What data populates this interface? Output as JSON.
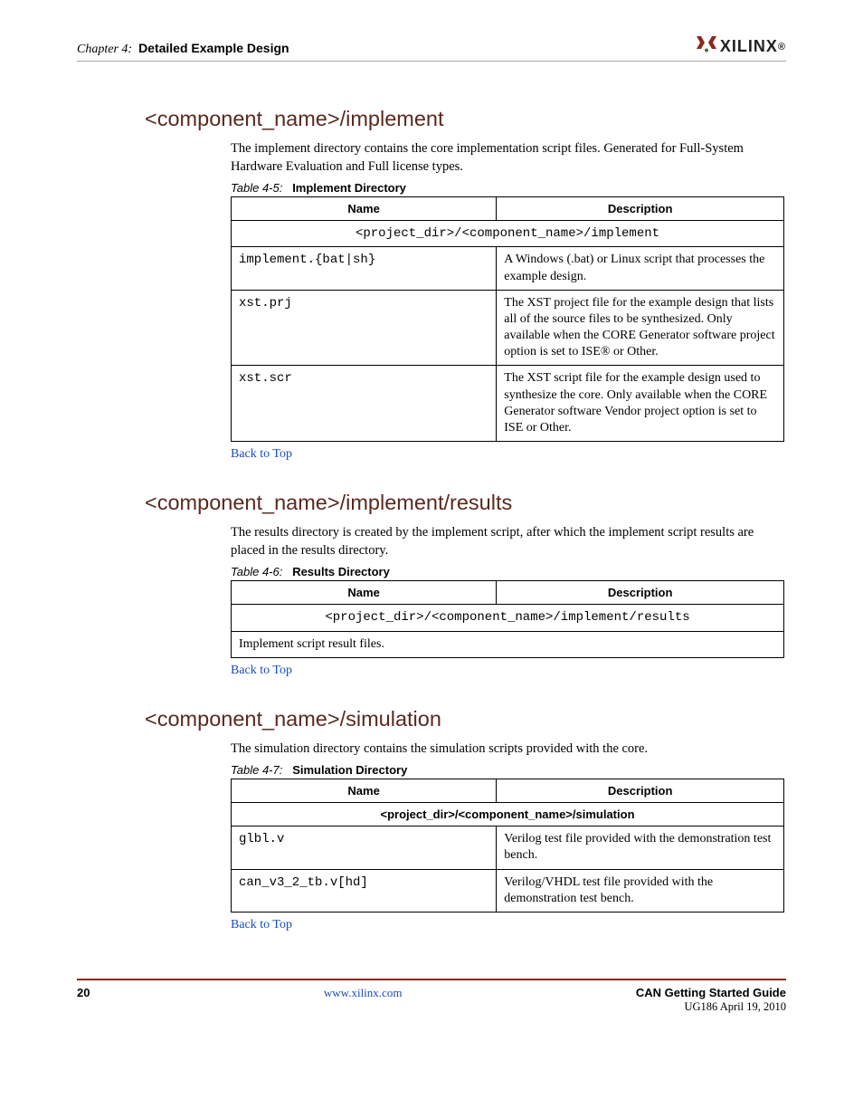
{
  "header": {
    "chapter_label": "Chapter 4:",
    "chapter_title": "Detailed Example Design",
    "logo_text": "XILINX"
  },
  "sections": [
    {
      "heading": "<component_name>/implement",
      "intro": "The implement directory contains the core implementation script files. Generated for Full-System Hardware Evaluation and Full license types.",
      "table_caption_label": "Table 4-5:",
      "table_caption_title": "Implement Directory",
      "col1": "Name",
      "col2": "Description",
      "path_row": "<project_dir>/<component_name>/implement",
      "path_row_bold": false,
      "rows": [
        {
          "name": "implement.{bat|sh}",
          "desc": "A Windows (.bat) or Linux script that processes the example design."
        },
        {
          "name": "xst.prj",
          "desc": "The XST project file for the example design that lists all of the source files to be synthesized. Only available when the CORE Generator software project option is set to ISE® or Other."
        },
        {
          "name": "xst.scr",
          "desc": "The XST script file for the example design used to synthesize the core. Only available when the CORE Generator software Vendor project option is set to ISE or Other."
        }
      ],
      "back_link": "Back to Top"
    },
    {
      "heading": "<component_name>/implement/results",
      "intro": "The results directory is created by the implement script, after which the implement script results are placed in the results directory.",
      "table_caption_label": "Table 4-6:",
      "table_caption_title": "Results Directory",
      "col1": "Name",
      "col2": "Description",
      "path_row": "<project_dir>/<component_name>/implement/results",
      "path_row_bold": false,
      "rows": [
        {
          "name_full": "Implement script result files.",
          "desc": ""
        }
      ],
      "back_link": "Back to Top"
    },
    {
      "heading": "<component_name>/simulation",
      "intro": "The simulation directory contains the simulation scripts provided with the core.",
      "table_caption_label": "Table 4-7:",
      "table_caption_title": "Simulation Directory",
      "col1": "Name",
      "col2": "Description",
      "path_row": "<project_dir>/<component_name>/simulation",
      "path_row_bold": true,
      "rows": [
        {
          "name": "glbl.v",
          "desc": "Verilog test file provided with the demonstration test bench."
        },
        {
          "name": "can_v3_2_tb.v[hd]",
          "desc": "Verilog/VHDL test file provided with the demonstration test bench."
        }
      ],
      "back_link": "Back to Top"
    }
  ],
  "footer": {
    "page_num": "20",
    "url": "www.xilinx.com",
    "guide": "CAN Getting Started Guide",
    "ug": "UG186 April 19, 2010"
  }
}
